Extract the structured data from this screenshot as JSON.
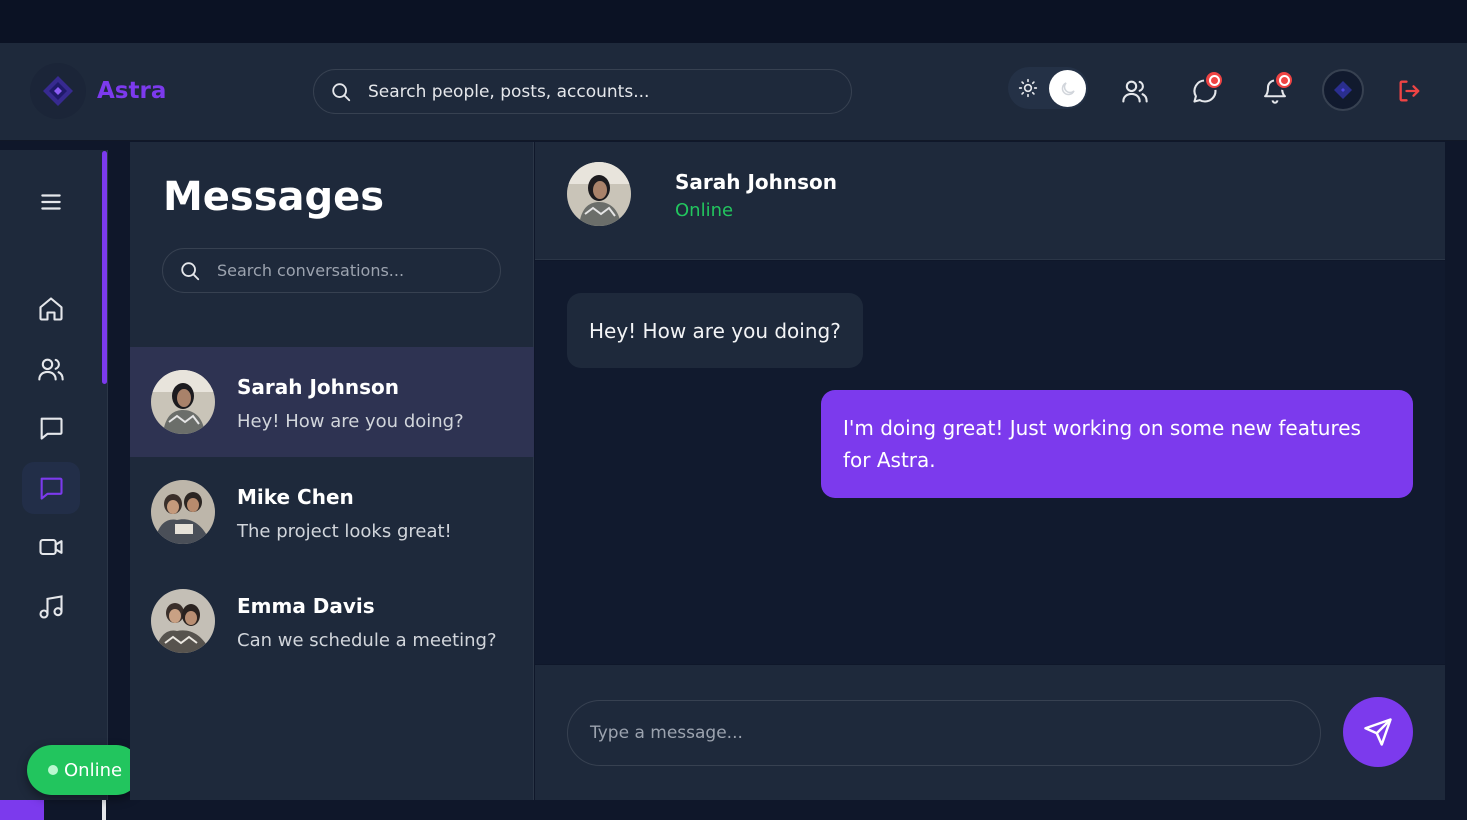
{
  "app": {
    "name": "Astra"
  },
  "header": {
    "search_placeholder": "Search people, posts, accounts...",
    "theme": "dark",
    "icons": [
      "sun-icon",
      "moon-icon",
      "friends-icon",
      "chat-notification-icon",
      "bell-icon",
      "profile-avatar",
      "logout-icon"
    ]
  },
  "sidebar": {
    "items": [
      {
        "icon": "menu-icon"
      },
      {
        "icon": "home-icon"
      },
      {
        "icon": "users-icon"
      },
      {
        "icon": "comment-icon"
      },
      {
        "icon": "messages-icon",
        "active": true
      },
      {
        "icon": "video-icon"
      },
      {
        "icon": "music-icon"
      }
    ],
    "status_label": "Online"
  },
  "conversations": {
    "title": "Messages",
    "search_placeholder": "Search conversations...",
    "items": [
      {
        "name": "Sarah Johnson",
        "preview": "Hey! How are you doing?",
        "active": true
      },
      {
        "name": "Mike Chen",
        "preview": "The project looks great!"
      },
      {
        "name": "Emma Davis",
        "preview": "Can we schedule a meeting?"
      }
    ]
  },
  "chat": {
    "contact_name": "Sarah Johnson",
    "contact_status": "Online",
    "messages": [
      {
        "direction": "incoming",
        "text": "Hey! How are you doing?"
      },
      {
        "direction": "outgoing",
        "text": "I'm doing great! Just working on some new features for Astra."
      }
    ],
    "input_placeholder": "Type a message..."
  },
  "colors": {
    "accent": "#7c3aed",
    "online": "#22c55e",
    "badge": "#ef4444",
    "logout": "#ef4444"
  }
}
